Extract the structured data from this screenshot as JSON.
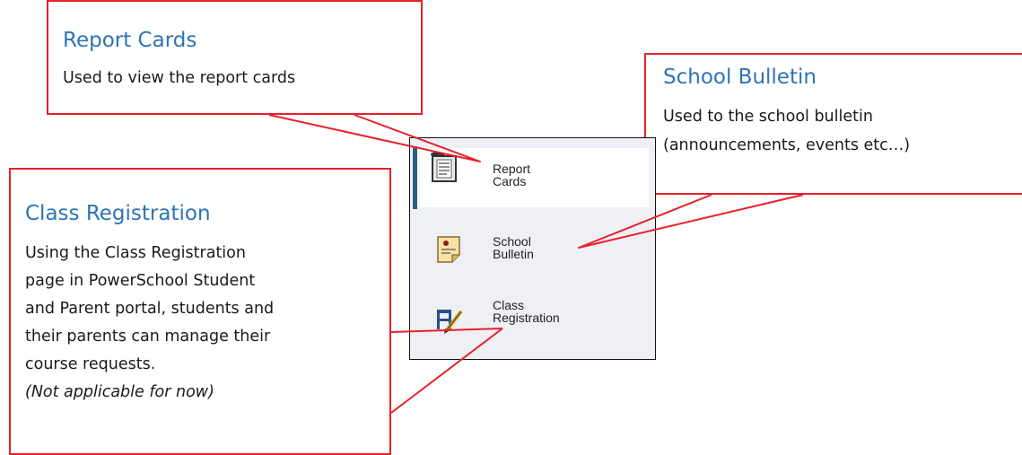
{
  "callouts": {
    "report_cards": {
      "title": "Report Cards",
      "text": "Used to view the report cards"
    },
    "school_bulletin": {
      "title": "School Bulletin",
      "line1": "Used to the school bulletin",
      "line2": "(announcements, events etc…)"
    },
    "class_registration": {
      "title": "Class Registration",
      "lines": [
        "Using the Class Registration",
        "page in PowerSchool Student",
        "and Parent portal, students and",
        "their parents can manage their",
        "course requests."
      ],
      "note": "(Not applicable for now)"
    }
  },
  "menu": {
    "items": [
      {
        "line1": "Report",
        "line2": "Cards",
        "icon": "report-card-icon",
        "active": true
      },
      {
        "line1": "School",
        "line2": "Bulletin",
        "icon": "bulletin-icon",
        "active": false
      },
      {
        "line1": "Class",
        "line2": "Registration",
        "icon": "class-registration-icon",
        "active": false
      }
    ]
  },
  "colors": {
    "callout_border": "#e8202a",
    "title": "#2e74b5",
    "active_bar": "#2f5f7e",
    "menu_bg": "#eef0f5"
  }
}
